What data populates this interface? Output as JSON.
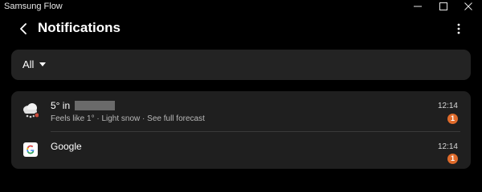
{
  "window": {
    "title": "Samsung Flow",
    "controls": {
      "minimize_icon": "minimize-icon",
      "maximize_icon": "maximize-icon",
      "close_icon": "close-icon"
    }
  },
  "header": {
    "back_icon": "chevron-left-icon",
    "title": "Notifications",
    "more_icon": "more-vertical-icon"
  },
  "filter": {
    "selected": "All",
    "dropdown_icon": "caret-down-icon"
  },
  "notifications": [
    {
      "app_icon": "weather-snow-cloud-icon",
      "title": "5° in",
      "title_redacted": true,
      "body": "Feels like 1° · Light snow · See full forecast",
      "time": "12:14",
      "badge": "1"
    },
    {
      "app_icon": "google-icon",
      "title": "Google",
      "body": "",
      "time": "12:14",
      "badge": "1"
    }
  ],
  "colors": {
    "background": "#000000",
    "surface": "#1f1f1f",
    "filter_surface": "#232323",
    "badge": "#e06b2b",
    "text_primary": "#ffffff",
    "text_secondary": "#b8b8b8"
  }
}
